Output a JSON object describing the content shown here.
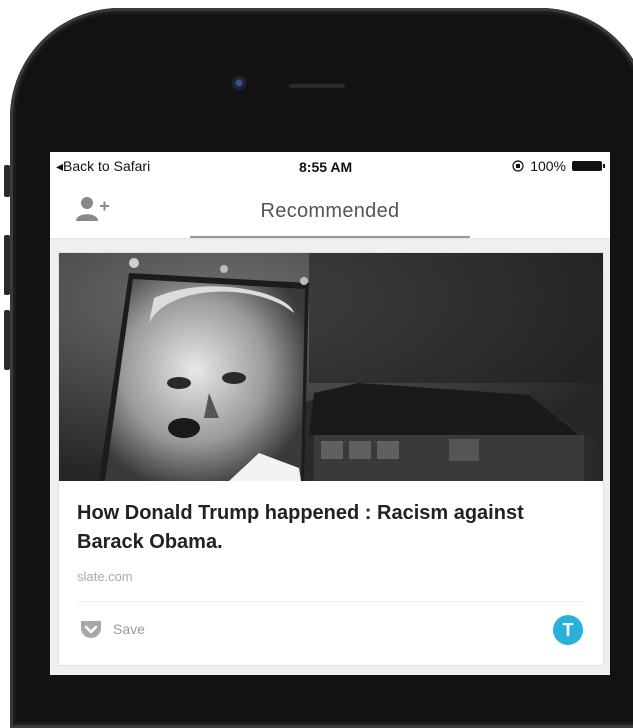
{
  "status_bar": {
    "back_label": "◂Back to Safari",
    "time": "8:55 AM",
    "battery_percent": "100%"
  },
  "nav": {
    "title": "Recommended",
    "add_user_icon": "add-user-icon"
  },
  "card": {
    "headline": "How Donald Trump happened : Racism against Barack Obama.",
    "source": "slate.com",
    "save_label": "Save",
    "badge_letter": "T",
    "badge_color": "#2ab3da"
  }
}
